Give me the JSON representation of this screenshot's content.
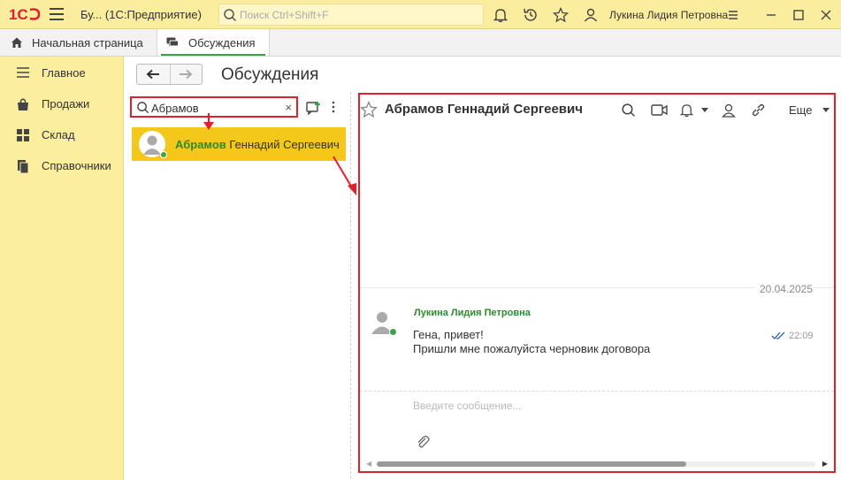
{
  "app": {
    "title": "Бу...   (1С:Предприятие)",
    "search_placeholder": "Поиск Ctrl+Shift+F",
    "user_name": "Лукина Лидия Петровна"
  },
  "tabs": [
    {
      "label": "Начальная страница"
    },
    {
      "label": "Обсуждения"
    }
  ],
  "sidebar": {
    "items": [
      {
        "label": "Главное",
        "icon": "menu-lines-icon"
      },
      {
        "label": "Продажи",
        "icon": "shopping-bag-icon"
      },
      {
        "label": "Склад",
        "icon": "grid-icon"
      },
      {
        "label": "Справочники",
        "icon": "books-icon"
      }
    ]
  },
  "page": {
    "title": "Обсуждения"
  },
  "list": {
    "search_value": "Абрамов",
    "clear_icon": "×",
    "contacts": [
      {
        "highlight": "Абрамов",
        "rest": " Геннадий Сергеевич",
        "online": true
      }
    ]
  },
  "chat": {
    "title": "Абрамов Геннадий Сергеевич",
    "more_label": "Еще",
    "date": "20.04.2025",
    "messages": [
      {
        "author": "Лукина Лидия Петровна",
        "lines": [
          "Гена, привет!",
          "Пришли мне пожалуйста черновик договора"
        ],
        "time": "22:09",
        "read": true
      }
    ],
    "input_placeholder": "Введите сообщение..."
  },
  "colors": {
    "accent_yellow": "#fbee9f",
    "selected_yellow": "#f4c81b",
    "green": "#3fa04a",
    "annotation_red": "#e0202c"
  }
}
